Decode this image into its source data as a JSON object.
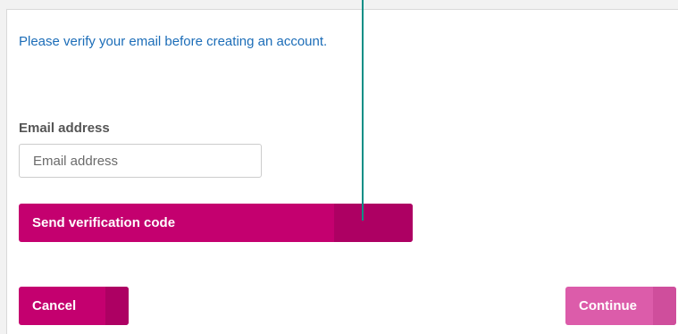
{
  "form": {
    "intro_text": "Please verify your email before creating an account.",
    "email": {
      "label": "Email address",
      "placeholder": "Email address",
      "value": ""
    }
  },
  "buttons": {
    "send_code": "Send verification code",
    "cancel": "Cancel",
    "continue": "Continue"
  },
  "colors": {
    "primary": "#c4006f",
    "primary_shade": "#ad0063",
    "continue": "#dc5caa",
    "intro_text": "#1c6db8",
    "overlay_line": "#0b8f86"
  }
}
